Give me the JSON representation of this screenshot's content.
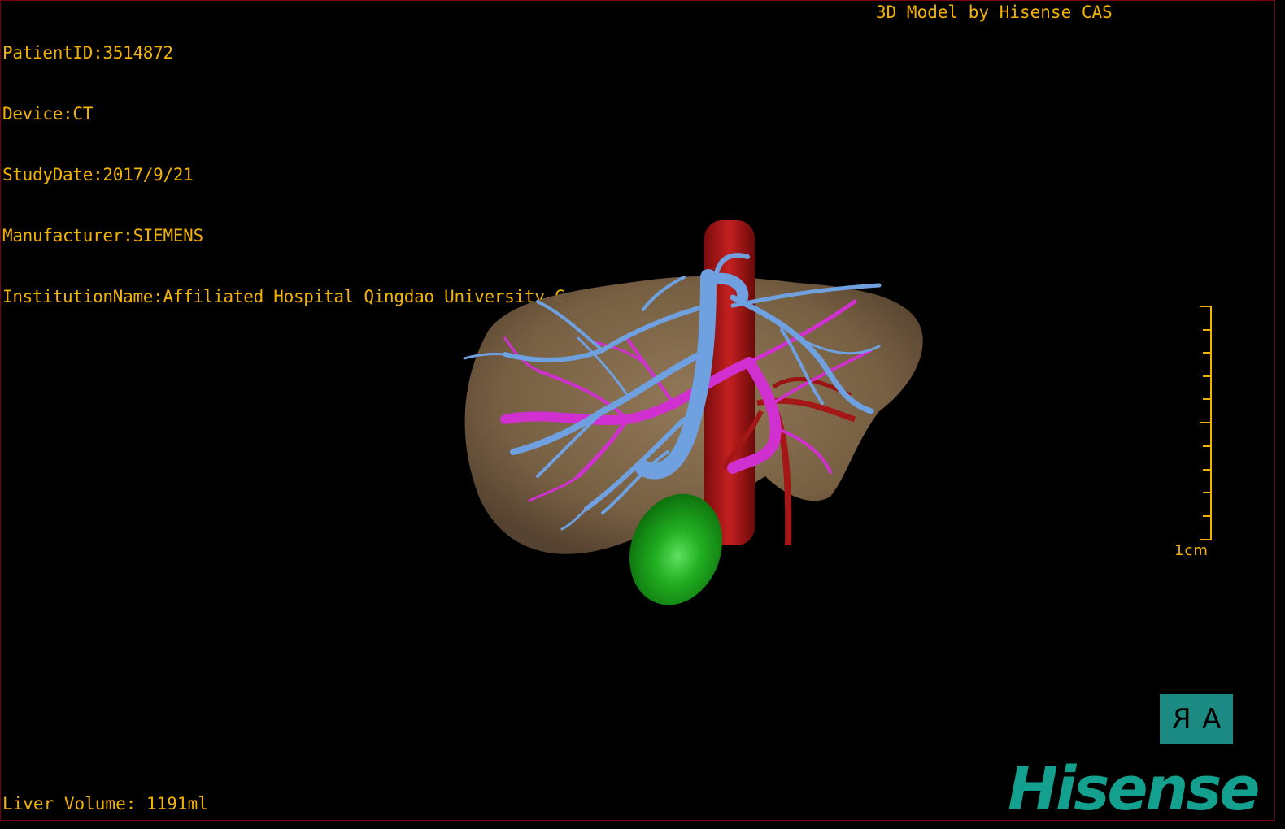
{
  "overlay": {
    "patient_id": "PatientID:3514872",
    "device": "Device:CT",
    "study_date": "StudyDate:2017/9/21",
    "manufacturer": "Manufacturer:SIEMENS",
    "institution": "InstitutionName:Affiliated Hospital Qingdao University-C",
    "credit": "3D Model by Hisense CAS",
    "liver_volume": "Liver Volume: 1191ml"
  },
  "scale": {
    "label": "1cm"
  },
  "orientation": {
    "left_letter": "R",
    "right_letter": "A"
  },
  "brand": {
    "logo_text": "Hisense"
  },
  "colors": {
    "text": "#f2b300",
    "liver": "#8a7050",
    "portal_vein": "#6fa0e0",
    "hepatic_vein": "#d030d0",
    "artery": "#b01818",
    "gallbladder": "#18a018",
    "brand": "#13a08f"
  },
  "icons": {
    "orientation": "orientation-cube-icon",
    "logo": "hisense-logo"
  }
}
